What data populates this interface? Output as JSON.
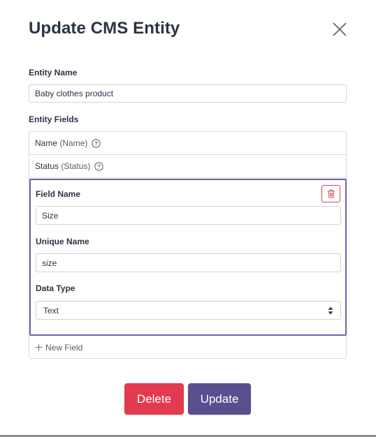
{
  "modal": {
    "title": "Update CMS Entity"
  },
  "entity_name": {
    "label": "Entity Name",
    "value": "Baby clothes product"
  },
  "entity_fields": {
    "label": "Entity Fields",
    "fields": [
      {
        "name": "Name",
        "alias": "(Name)"
      },
      {
        "name": "Status",
        "alias": "(Status)"
      }
    ],
    "editor": {
      "field_name_label": "Field Name",
      "field_name_value": "Size",
      "unique_name_label": "Unique Name",
      "unique_name_value": "size",
      "data_type_label": "Data Type",
      "data_type_value": "Text"
    },
    "new_field_label": "New Field"
  },
  "actions": {
    "delete_label": "Delete",
    "update_label": "Update"
  },
  "colors": {
    "accent": "#5b4e8f",
    "danger": "#e23a4f",
    "editor_border": "#6e63a8"
  },
  "icons": {
    "close": "close-icon",
    "help": "help-circle-icon",
    "trash": "trash-icon",
    "select_arrows": "sort-arrows-icon",
    "plus": "plus-icon"
  }
}
